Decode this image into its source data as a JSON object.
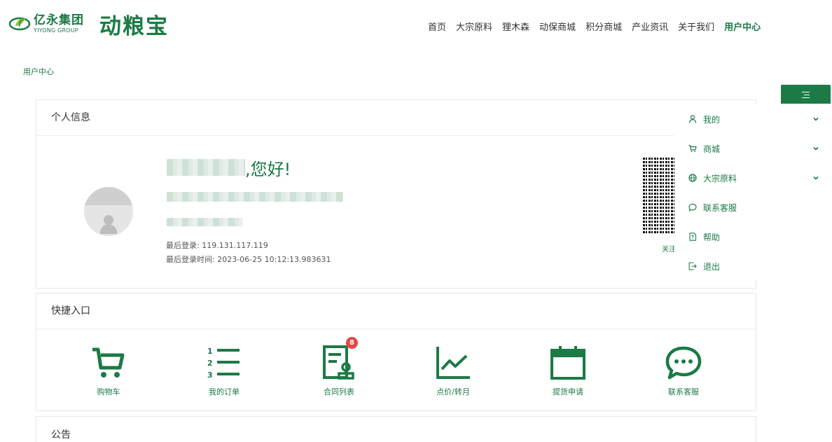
{
  "header": {
    "logo_cn": "亿永集团",
    "logo_en": "YIYONG GROUP",
    "brand": "动粮宝",
    "nav": [
      {
        "label": "首页"
      },
      {
        "label": "大宗原料"
      },
      {
        "label": "狸木森"
      },
      {
        "label": "动保商城"
      },
      {
        "label": "积分商城"
      },
      {
        "label": "产业资讯"
      },
      {
        "label": "关于我们"
      },
      {
        "label": "用户中心",
        "active": true
      }
    ]
  },
  "breadcrumb": "用户中心",
  "info": {
    "title": "个人信息",
    "greeting": ",您好!",
    "last_login_ip_label": "最后登录:",
    "last_login_ip": "119.131.117.119",
    "last_login_time_label": "最后登录时间:",
    "last_login_time": "2023-06-25 10:12:13.983631",
    "qr_label": "关注"
  },
  "quick": {
    "title": "快捷入口",
    "items": [
      {
        "label": "购物车",
        "icon": "cart-icon"
      },
      {
        "label": "我的订单",
        "icon": "order-list-icon"
      },
      {
        "label": "合同列表",
        "icon": "contract-icon",
        "badge": "8"
      },
      {
        "label": "点价/转月",
        "icon": "line-chart-icon"
      },
      {
        "label": "提货申请",
        "icon": "calendar-icon"
      },
      {
        "label": "联系客服",
        "icon": "chat-icon"
      }
    ]
  },
  "notice": {
    "title": "公告"
  },
  "side_menu": {
    "items": [
      {
        "label": "我的",
        "icon": "user-icon",
        "expandable": true
      },
      {
        "label": "商城",
        "icon": "cart-icon",
        "expandable": true
      },
      {
        "label": "大宗原料",
        "icon": "globe-icon",
        "expandable": true
      },
      {
        "label": "联系客服",
        "icon": "chat-icon",
        "expandable": false
      },
      {
        "label": "帮助",
        "icon": "help-icon",
        "expandable": false
      },
      {
        "label": "退出",
        "icon": "logout-icon",
        "expandable": false
      }
    ]
  },
  "colors": {
    "brand": "#1b7a45",
    "badge": "#e84545"
  }
}
